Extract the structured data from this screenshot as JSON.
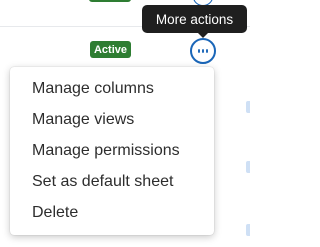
{
  "tooltip": {
    "text": "More actions"
  },
  "rows": [
    {
      "status": ""
    },
    {
      "status": "Active"
    }
  ],
  "more_actions_button": {
    "icon": "more-horizontal-icon"
  },
  "menu": {
    "items": [
      {
        "label": "Manage columns"
      },
      {
        "label": "Manage views"
      },
      {
        "label": "Manage permissions"
      },
      {
        "label": "Set as default sheet"
      },
      {
        "label": "Delete"
      }
    ]
  },
  "colors": {
    "active_badge": "#2e7d32",
    "accent": "#1a66b8",
    "tooltip_bg": "#1f1f1f"
  }
}
